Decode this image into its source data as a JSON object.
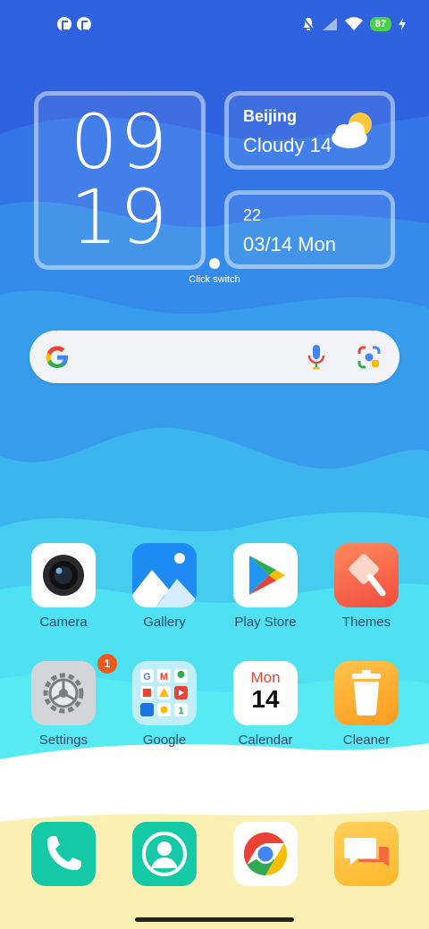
{
  "status_bar": {
    "battery_level": "87",
    "icons": [
      "app-notification-icon",
      "app-notification-icon",
      "mute-icon",
      "signal-icon",
      "wifi-icon",
      "battery-icon",
      "charging-icon"
    ]
  },
  "clock_widget": {
    "hours": "09",
    "minutes": "19"
  },
  "weather_widget": {
    "city": "Beijing",
    "condition": "Cloudy 14",
    "icon": "partly-cloudy-icon"
  },
  "date_widget": {
    "day": "22",
    "date": "03/14 Mon"
  },
  "switch_label": "Click switch",
  "search": {
    "logo": "google-logo-icon",
    "voice": "mic-icon",
    "lens": "lens-camera-icon"
  },
  "apps": [
    {
      "label": "Camera"
    },
    {
      "label": "Gallery"
    },
    {
      "label": "Play Store"
    },
    {
      "label": "Themes"
    },
    {
      "label": "Settings",
      "badge": "1"
    },
    {
      "label": "Google"
    },
    {
      "label": "Calendar",
      "icon_day_name": "Mon",
      "icon_day_number": "14"
    },
    {
      "label": "Cleaner"
    }
  ],
  "dock": [
    {
      "name": "phone-icon"
    },
    {
      "name": "contacts-icon"
    },
    {
      "name": "chrome-icon"
    },
    {
      "name": "messages-icon"
    }
  ],
  "colors": {
    "sky_top": "#2b5fe0",
    "wave_mid": "#3aa6ee",
    "wave_light": "#52e6f2",
    "sand": "#fbf0b4"
  }
}
